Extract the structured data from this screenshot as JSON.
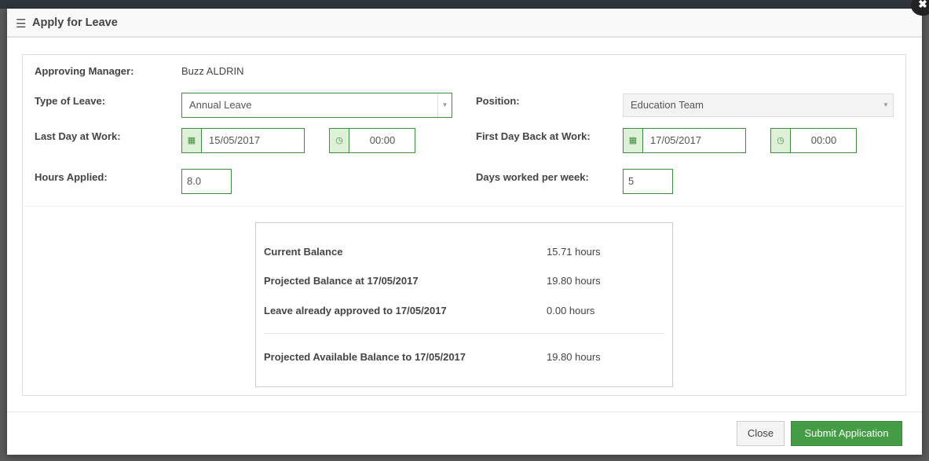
{
  "modal": {
    "title": "Apply for Leave",
    "menu_icon": "hamburger-icon",
    "close_icon": "close-icon"
  },
  "form": {
    "approving_manager": {
      "label": "Approving Manager:",
      "value": "Buzz ALDRIN"
    },
    "type_of_leave": {
      "label": "Type of Leave:",
      "value": "Annual Leave"
    },
    "position": {
      "label": "Position:",
      "value": "Education Team"
    },
    "last_day": {
      "label": "Last Day at Work:",
      "date": "15/05/2017",
      "time": "00:00"
    },
    "first_day_back": {
      "label": "First Day Back at Work:",
      "date": "17/05/2017",
      "time": "00:00"
    },
    "hours_applied": {
      "label": "Hours Applied:",
      "value": "8.0"
    },
    "days_per_week": {
      "label": "Days worked per week:",
      "value": "5"
    }
  },
  "balance": [
    {
      "label": "Current Balance",
      "value": "15.71 hours"
    },
    {
      "label": "Projected Balance at 17/05/2017",
      "value": "19.80 hours"
    },
    {
      "label": "Leave already approved to 17/05/2017",
      "value": "0.00 hours"
    },
    {
      "label": "Projected Available Balance to 17/05/2017",
      "value": "19.80 hours"
    }
  ],
  "footer": {
    "close": "Close",
    "submit": "Submit Application"
  },
  "colors": {
    "accent": "#3c8d3c",
    "submit": "#449d44"
  }
}
